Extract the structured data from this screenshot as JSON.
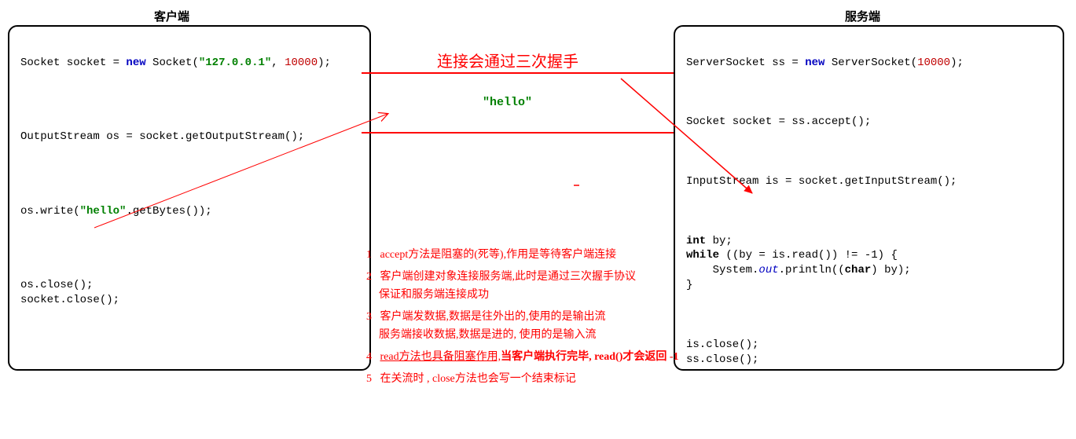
{
  "titles": {
    "client": "客户端",
    "server": "服务端"
  },
  "client_code": {
    "l1a": "Socket socket = ",
    "l1_new": "new",
    "l1b": " Socket(",
    "l1_ip": "\"127.0.0.1\"",
    "l1c": ", ",
    "l1_port": "10000",
    "l1d": ");",
    "l2": "OutputStream os = socket.getOutputStream();",
    "l3a": "os.write(",
    "l3_str": "\"hello\"",
    "l3b": ".getBytes());",
    "l4": "os.close();",
    "l5": "socket.close();"
  },
  "server_code": {
    "l1a": "ServerSocket ss = ",
    "l1_new": "new",
    "l1b": " ServerSocket(",
    "l1_port": "10000",
    "l1c": ");",
    "l2": "Socket socket = ss.accept();",
    "l3": "InputStream is = socket.getInputStream();",
    "l4_int": "int",
    "l4a": " by;",
    "l5_while": "while",
    "l5a": " ((by = is.read()) != -1) {",
    "l6a": "    System.",
    "l6_out": "out",
    "l6b": ".println((",
    "l6_char": "char",
    "l6c": ") by);",
    "l7": "}",
    "l8": "is.close();",
    "l9": "ss.close();"
  },
  "middle": {
    "handshake": "连接会通过三次握手",
    "hello": "\"hello\""
  },
  "notes": {
    "n1": {
      "num": "1",
      "line1": "accept方法是阻塞的(死等),作用是等待客户端连接"
    },
    "n2": {
      "num": "2",
      "line1": "客户端创建对象连接服务端,此时是通过三次握手协议",
      "line2": "保证和服务端连接成功"
    },
    "n3": {
      "num": "3",
      "line1": "客户端发数据,数据是往外出的,使用的是输出流",
      "line2": "服务端接收数据,数据是进的, 使用的是输入流"
    },
    "n4": {
      "num": "4",
      "line1a": "read方法也具备阻塞作用,",
      "line1b": "当客户端执行完毕, read()才会返回 -1"
    },
    "n5": {
      "num": "5",
      "line1": "在关流时 , close方法也会写一个结束标记"
    }
  }
}
